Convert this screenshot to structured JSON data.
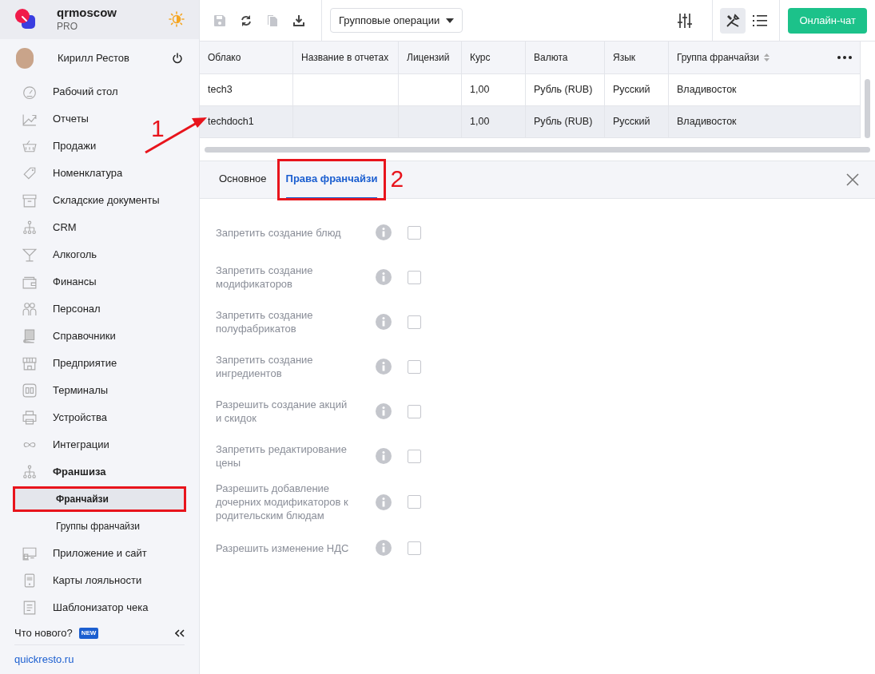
{
  "brand": {
    "name": "qrmoscow",
    "plan": "PRO"
  },
  "user": {
    "name": "Кирилл Рестов"
  },
  "sidebar": {
    "items": [
      {
        "label": "Рабочий стол",
        "selected": false
      },
      {
        "label": "Отчеты",
        "selected": false
      },
      {
        "label": "Продажи",
        "selected": false
      },
      {
        "label": "Номенклатура",
        "selected": false
      },
      {
        "label": "Складские документы",
        "selected": false
      },
      {
        "label": "CRM",
        "selected": false
      },
      {
        "label": "Алкоголь",
        "selected": false
      },
      {
        "label": "Финансы",
        "selected": false
      },
      {
        "label": "Персонал",
        "selected": false
      },
      {
        "label": "Справочники",
        "selected": false
      },
      {
        "label": "Предприятие",
        "selected": false
      },
      {
        "label": "Терминалы",
        "selected": false
      },
      {
        "label": "Устройства",
        "selected": false
      },
      {
        "label": "Интеграции",
        "selected": false
      },
      {
        "label": "Франшиза",
        "selected": true,
        "children": [
          {
            "label": "Франчайзи",
            "selected": true,
            "highlighted": true
          },
          {
            "label": "Группы франчайзи",
            "selected": false,
            "highlighted": false
          }
        ]
      },
      {
        "label": "Приложение и сайт",
        "selected": false
      },
      {
        "label": "Карты лояльности",
        "selected": false
      },
      {
        "label": "Шаблонизатор чека",
        "selected": false
      }
    ],
    "whats_new": "Что нового?",
    "new_badge": "NEW",
    "footer_link": "quickresto.ru"
  },
  "toolbar": {
    "group_operations": "Групповые операции",
    "chat_button": "Онлайн-чат"
  },
  "table": {
    "columns": [
      "Облако",
      "Название в отчетах",
      "Лицензий",
      "Курс",
      "Валюта",
      "Язык",
      "Группа франчайзи"
    ],
    "rows": [
      {
        "cells": [
          "tech3",
          "",
          "",
          "1,00",
          "Рубль (RUB)",
          "Русский",
          "Владивосток"
        ],
        "selected": false
      },
      {
        "cells": [
          "techdoch1",
          "",
          "",
          "1,00",
          "Рубль (RUB)",
          "Русский",
          "Владивосток"
        ],
        "selected": true,
        "callout": "1"
      }
    ]
  },
  "tabs": [
    {
      "label": "Основное",
      "selected": false,
      "highlighted": false
    },
    {
      "label": "Права франчайзи",
      "selected": true,
      "highlighted": true,
      "callout": "2"
    }
  ],
  "settings": [
    {
      "label": "Запретить создание блюд",
      "checked": false
    },
    {
      "label": "Запретить создание модификаторов",
      "checked": false
    },
    {
      "label": "Запретить создание полуфабрикатов",
      "checked": false
    },
    {
      "label": "Запретить создание ингредиентов",
      "checked": false
    },
    {
      "label": "Разрешить создание акций и скидок",
      "checked": false
    },
    {
      "label": "Запретить редактирование цены",
      "checked": false
    },
    {
      "label": "Разрешить добавление дочерних модификаторов к родительским блюдам",
      "checked": false
    },
    {
      "label": "Разрешить изменение НДС",
      "checked": false
    }
  ]
}
